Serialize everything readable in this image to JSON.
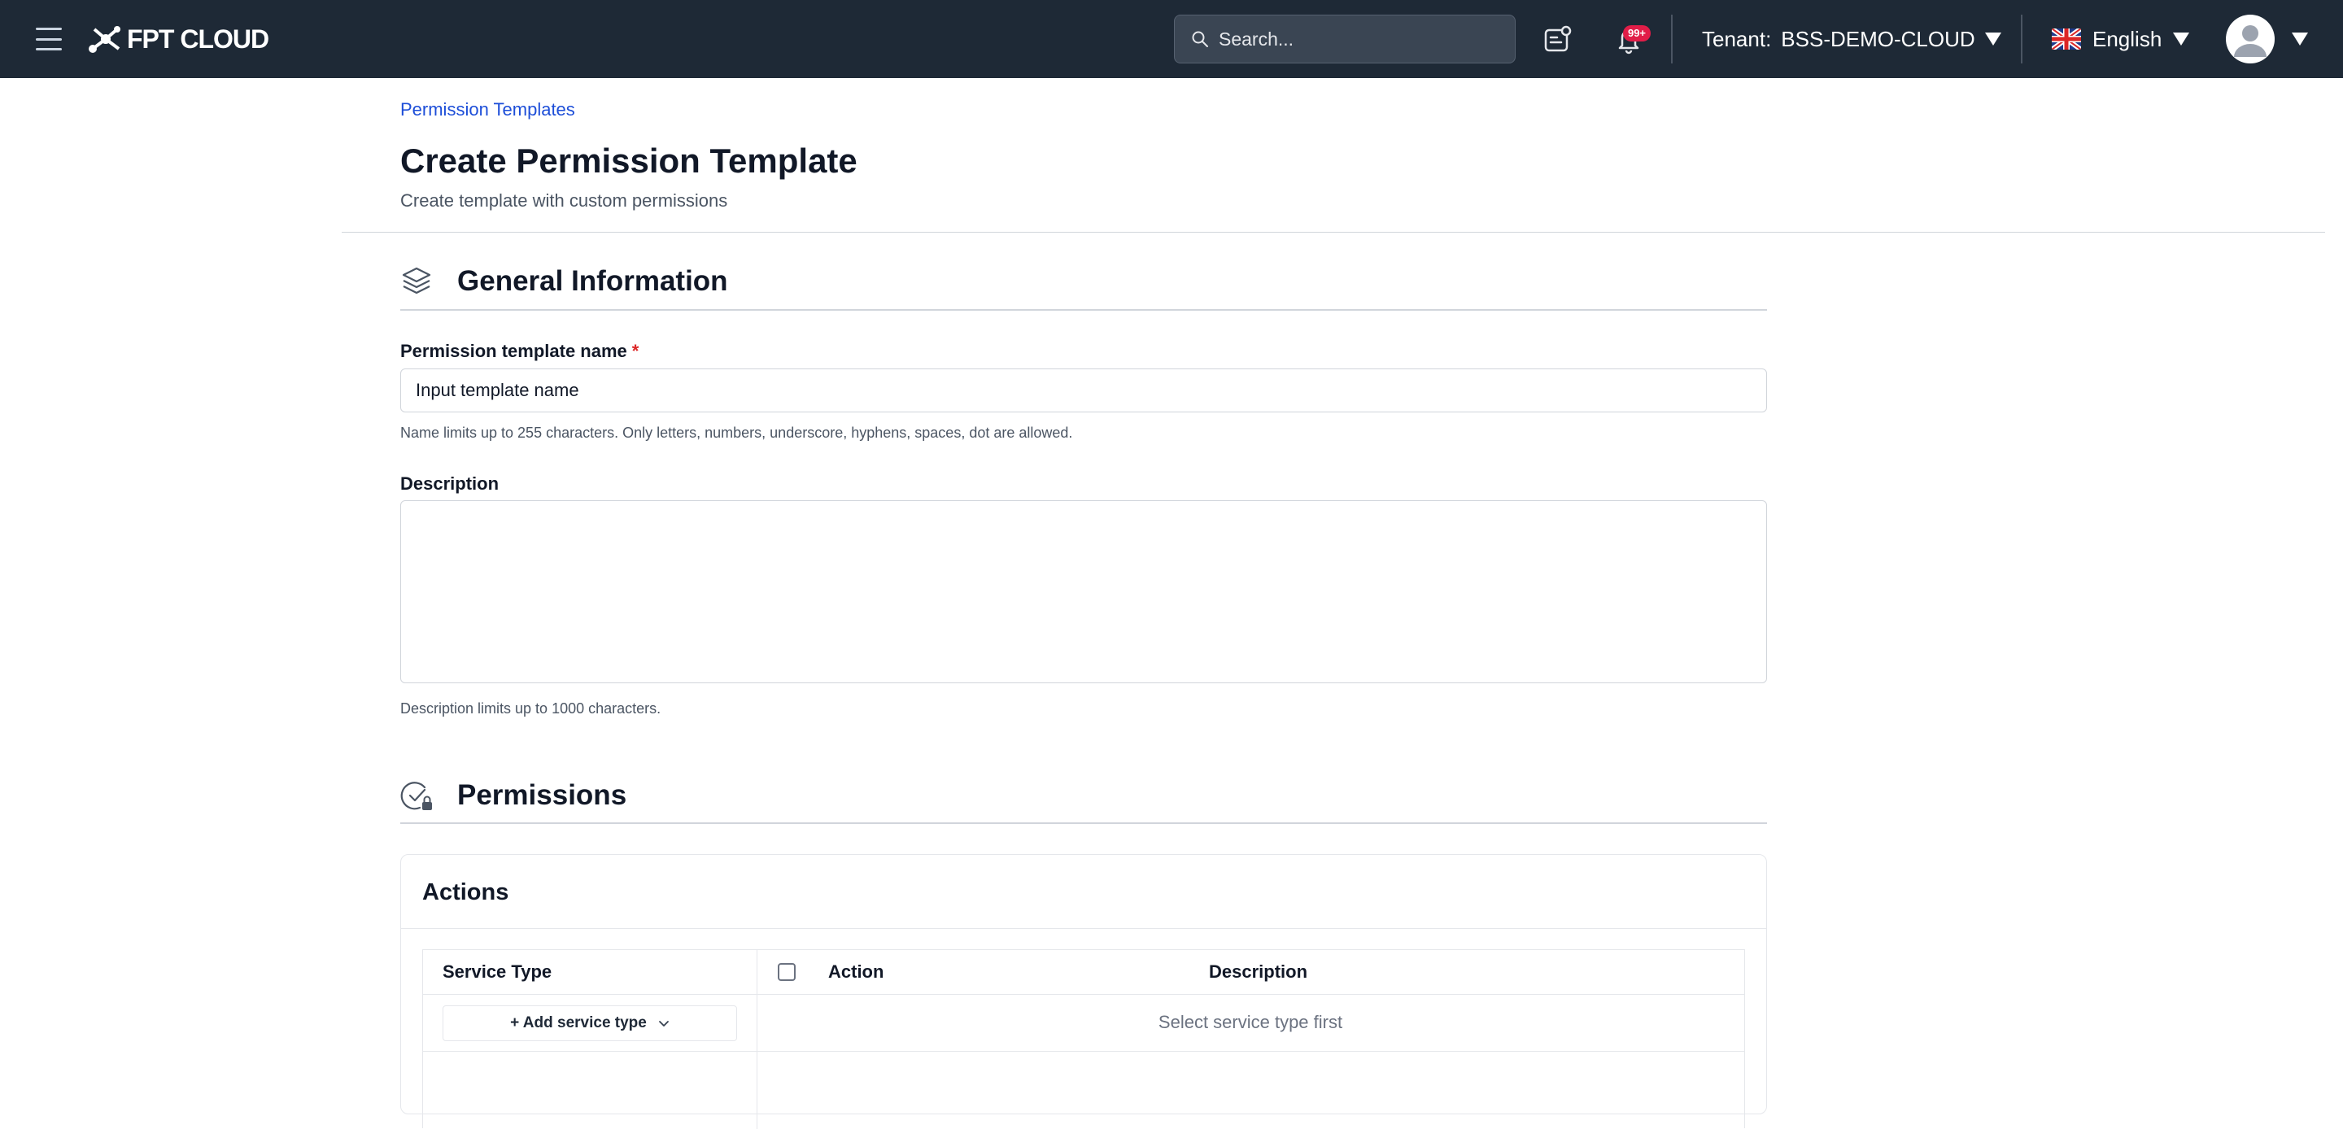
{
  "topbar": {
    "logo_text": "FPT CLOUD",
    "search_placeholder": "Search...",
    "notification_badge": "99+",
    "tenant_label": "Tenant:",
    "tenant_value": "BSS-DEMO-CLOUD",
    "language": "English"
  },
  "header": {
    "breadcrumb": "Permission Templates",
    "title": "Create Permission Template",
    "subtitle": "Create template with custom permissions"
  },
  "general": {
    "title": "General Information",
    "name_label": "Permission template name",
    "required_mark": "*",
    "name_placeholder": "Input template name",
    "name_hint": "Name limits up to 255 characters. Only letters, numbers, underscore, hyphens, spaces, dot are allowed.",
    "description_label": "Description",
    "description_value": "",
    "description_hint": "Description limits up to 1000 characters."
  },
  "permissions": {
    "title": "Permissions",
    "actions_title": "Actions",
    "columns": [
      "Service Type",
      "Action",
      "Description"
    ],
    "add_service_label": "+ Add service type",
    "empty_message": "Select service type first"
  },
  "colors": {
    "topbar_bg": "#1e2936",
    "link": "#1d4ed8",
    "badge": "#e11d48",
    "required": "#dc2626"
  }
}
